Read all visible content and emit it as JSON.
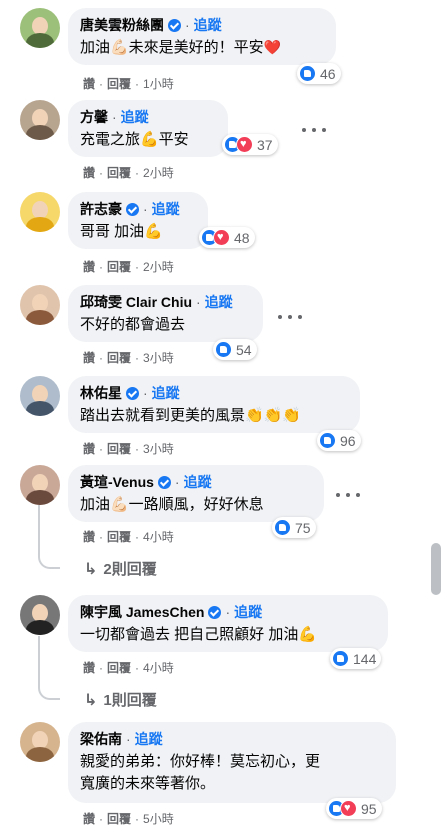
{
  "follow_label": "追蹤",
  "actions": {
    "like": "讚",
    "reply": "回覆"
  },
  "comments": [
    {
      "name": "唐美雲粉絲團",
      "verified": true,
      "text": "加油💪🏻未來是美好的！平安",
      "end_emoji": "❤️",
      "reactions": [
        "like"
      ],
      "count": "46",
      "time": "1小時",
      "avatar_color": "#6f8c5a"
    },
    {
      "name": "方馨",
      "verified": false,
      "text": "充電之旅💪平安",
      "reactions": [
        "like",
        "love"
      ],
      "count": "37",
      "time": "2小時",
      "avatar_color": "#7a6a58"
    },
    {
      "name": "許志豪",
      "verified": true,
      "text": "哥哥 加油💪",
      "reactions": [
        "like",
        "love"
      ],
      "count": "48",
      "time": "2小時",
      "avatar_color": "#f2c322"
    },
    {
      "name": "邱琦雯 Clair Chiu",
      "verified": false,
      "text": "不好的都會過去",
      "reactions": [
        "like"
      ],
      "count": "54",
      "time": "3小時",
      "avatar_color": "#c7a489"
    },
    {
      "name": "林佑星",
      "verified": true,
      "text": "踏出去就看到更美的風景👏👏👏",
      "reactions": [
        "like"
      ],
      "count": "96",
      "time": "3小時",
      "avatar_color": "#5f7a94"
    },
    {
      "name": "黃瑄-Venus",
      "verified": true,
      "text": "加油💪🏻一路順風，好好休息",
      "reactions": [
        "like"
      ],
      "count": "75",
      "time": "4小時",
      "avatar_color": "#8a6f63"
    },
    {
      "name": "陳宇風 JamesChen",
      "verified": true,
      "text": "一切都會過去 把自己照顧好 加油💪",
      "reactions": [
        "like"
      ],
      "count": "144",
      "time": "4小時",
      "avatar_color": "#3a3a3a"
    },
    {
      "name": "梁佑南",
      "verified": false,
      "text_line1": "親愛的弟弟：你好棒！莫忘初心，更",
      "text_line2": "寬廣的未來等著你。",
      "reactions": [
        "like",
        "love"
      ],
      "count": "95",
      "time": "5小時",
      "avatar_color": "#b08860"
    }
  ],
  "replies": [
    {
      "label": "2則回覆"
    },
    {
      "label": "1則回覆"
    }
  ],
  "icons": {
    "more": "more-horizontal-icon",
    "reply_arrow": "reply-arrow-icon",
    "like": "like-reaction-icon",
    "love": "love-reaction-icon",
    "verified": "verified-badge-icon"
  }
}
